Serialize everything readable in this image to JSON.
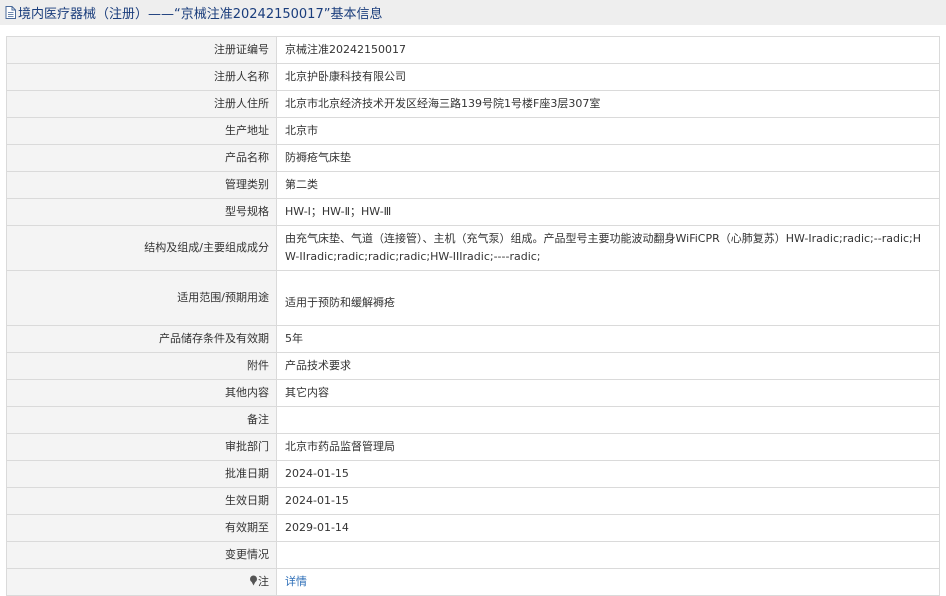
{
  "page": {
    "title": "境内医疗器械（注册）——“京械注准20242150017”基本信息"
  },
  "rows": [
    {
      "label": "注册证编号",
      "value": "京械注准20242150017"
    },
    {
      "label": "注册人名称",
      "value": "北京护卧康科技有限公司"
    },
    {
      "label": "注册人住所",
      "value": "北京市北京经济技术开发区经海三路139号院1号楼F座3层307室"
    },
    {
      "label": "生产地址",
      "value": "北京市"
    },
    {
      "label": "产品名称",
      "value": "防褥疮气床垫"
    },
    {
      "label": "管理类别",
      "value": "第二类"
    },
    {
      "label": "型号规格",
      "value": "HW-Ⅰ；HW-Ⅱ；HW-Ⅲ"
    },
    {
      "label": "结构及组成/主要组成成分",
      "value": "由充气床垫、气道（连接管）、主机（充气泵）组成。产品型号主要功能波动翻身WiFiCPR（心肺复苏）HW-Iradic;radic;--radic;HW-IIradic;radic;radic;radic;HW-IIIradic;----radic;"
    },
    {
      "label": "适用范围/预期用途",
      "value": "适用于预防和缓解褥疮"
    },
    {
      "label": "产品储存条件及有效期",
      "value": "5年"
    },
    {
      "label": "附件",
      "value": "产品技术要求"
    },
    {
      "label": "其他内容",
      "value": "其它内容"
    },
    {
      "label": "备注",
      "value": ""
    },
    {
      "label": "审批部门",
      "value": "北京市药品监督管理局"
    },
    {
      "label": "批准日期",
      "value": "2024-01-15"
    },
    {
      "label": "生效日期",
      "value": "2024-01-15"
    },
    {
      "label": "有效期至",
      "value": "2029-01-14"
    },
    {
      "label": "变更情况",
      "value": ""
    },
    {
      "label": "注",
      "value": "详情"
    }
  ],
  "colors": {
    "title_text": "#1a3d7c",
    "link": "#2b6db7"
  },
  "icons": {
    "title": "document-icon",
    "note": "pin-icon"
  }
}
